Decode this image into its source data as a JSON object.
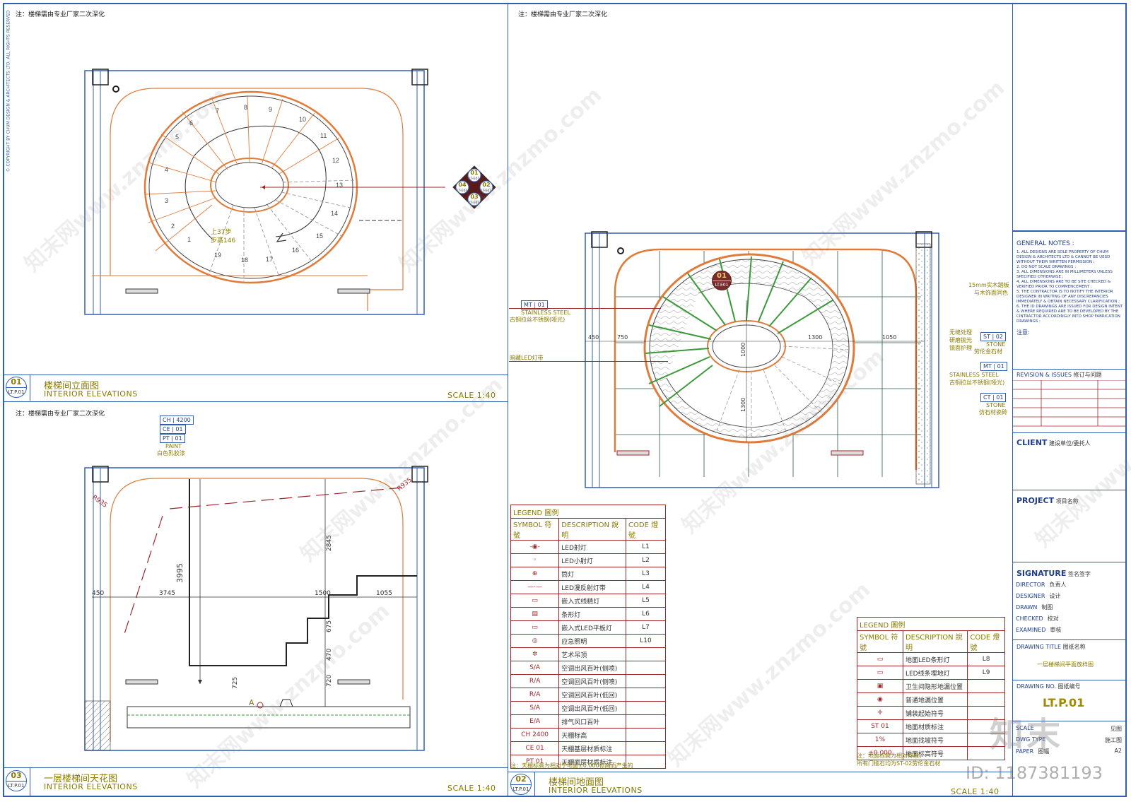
{
  "panels": {
    "p01": {
      "note": "注：楼梯需由专业厂家二次深化",
      "bubble_num": "01",
      "bubble_sheet": "LT.P.01",
      "title_cn": "楼梯间立面图",
      "title_en": "INTERIOR ELEVATIONS",
      "scale": "SCALE 1:40",
      "step_numbers": [
        "1",
        "2",
        "3",
        "4",
        "5",
        "6",
        "7",
        "8",
        "9",
        "10",
        "11",
        "12",
        "13",
        "14",
        "15",
        "16",
        "17",
        "18",
        "19"
      ],
      "step_note_1": "上37步",
      "step_note_2": "步高146",
      "section_marks": [
        {
          "num": "01",
          "sheet": "LT-E01"
        },
        {
          "num": "02",
          "sheet": "LT-E02"
        },
        {
          "num": "03",
          "sheet": "LT-E03"
        },
        {
          "num": "04",
          "sheet": "LT-E04"
        }
      ]
    },
    "p03": {
      "note": "注：楼梯需由专业厂家二次深化",
      "bubble_num": "03",
      "bubble_sheet": "LT.P.01",
      "title_cn": "一层楼梯间天花图",
      "title_en": "INTERIOR ELEVATIONS",
      "scale": "SCALE 1:40",
      "ceiling_tags": [
        {
          "code": "CH",
          "val": "4200"
        },
        {
          "code": "CE",
          "val": "01"
        },
        {
          "code": "PT",
          "val": "01"
        }
      ],
      "paint_label_en": "PAINT",
      "paint_label_cn": "白色乳胶漆",
      "dims": [
        "450",
        "3745",
        "1500",
        "1055",
        "3995",
        "2845",
        "675",
        "470",
        "720",
        "725",
        "R935",
        "R935"
      ],
      "mark_a": "A"
    },
    "p02": {
      "note": "注：楼梯需由专业厂家二次深化",
      "bubble_num": "02",
      "bubble_sheet": "LT.P.01",
      "title_cn": "楼梯间地面图",
      "title_en": "INTERIOR ELEVATIONS",
      "scale": "SCALE 1:40",
      "plan_bubble": "01",
      "plan_bubble_sheet": "LT.E01",
      "dims": [
        "450",
        "750",
        "1300",
        "1050",
        "1000",
        "1300"
      ],
      "tags": [
        {
          "code": "MT",
          "val": "01",
          "en": "STAINLESS STEEL",
          "cn": "古铜拉丝不锈钢(哑光)"
        },
        {
          "code": "ST",
          "val": "02",
          "en": "STONE",
          "cn": "劳伦金石材"
        },
        {
          "code": "MT",
          "val": "01",
          "en": "STAINLESS STEEL",
          "cn": "古铜拉丝不锈钢(哑光)"
        },
        {
          "code": "CT",
          "val": "01",
          "en": "STONE",
          "cn": "仿石材瓷砖"
        }
      ],
      "callout_wood": "15mm实木踏板",
      "callout_wood2": "与木饰面同色",
      "callout_led": "暗藏LED灯带",
      "callout_grout_1": "无缝处理",
      "callout_grout_2": "研磨抛光",
      "callout_grout_3": "镜面护理"
    }
  },
  "legend_ceiling": {
    "title": "LEGEND 圖例",
    "head": [
      "SYMBOL 符號",
      "DESCRIPTION 說明",
      "CODE 燈號"
    ],
    "rows": [
      {
        "sym": "-◉-",
        "desc": "LED射灯",
        "code": "L1"
      },
      {
        "sym": "◦",
        "desc": "LED小射灯",
        "code": "L2"
      },
      {
        "sym": "⊕",
        "desc": "筒灯",
        "code": "L3"
      },
      {
        "sym": "—·—",
        "desc": "LED漫反射灯带",
        "code": "L4"
      },
      {
        "sym": "▭",
        "desc": "嵌入式线精灯",
        "code": "L5"
      },
      {
        "sym": "▤",
        "desc": "条形灯",
        "code": "L6"
      },
      {
        "sym": "▭",
        "desc": "嵌入式LED平板灯",
        "code": "L7"
      },
      {
        "sym": "◎",
        "desc": "应急照明",
        "code": "L10"
      },
      {
        "sym": "✲",
        "desc": "艺术吊顶",
        "code": ""
      },
      {
        "sym": "S/A",
        "desc": "空调出风百叶(侧喷)",
        "code": ""
      },
      {
        "sym": "R/A",
        "desc": "空调回风百叶(侧喷)",
        "code": ""
      },
      {
        "sym": "R/A",
        "desc": "空调回风百叶(低回)",
        "code": ""
      },
      {
        "sym": "S/A",
        "desc": "空调出风百叶(低回)",
        "code": ""
      },
      {
        "sym": "E/A",
        "desc": "排气风口百叶",
        "code": ""
      },
      {
        "sym": "CH 2400",
        "desc": "天棚标高",
        "code": ""
      },
      {
        "sym": "CE 01",
        "desc": "天棚基层材质标注",
        "code": ""
      },
      {
        "sym": "PT 01",
        "desc": "天棚面层材质标注",
        "code": ""
      }
    ],
    "footnote": "注：天棚标高为相对于地面±0.000标高而产生的"
  },
  "legend_floor": {
    "title": "LEGEND 圖例",
    "head": [
      "SYMBOL 符號",
      "DESCRIPTION 說明",
      "CODE 燈號"
    ],
    "rows": [
      {
        "sym": "▭",
        "desc": "地面LED条形灯",
        "code": "L8"
      },
      {
        "sym": "▭",
        "desc": "LED线条埋地灯",
        "code": "L9"
      },
      {
        "sym": "▣",
        "desc": "卫生间隐形地漏位置",
        "code": ""
      },
      {
        "sym": "◉",
        "desc": "普通地漏位置",
        "code": ""
      },
      {
        "sym": "✛",
        "desc": "铺装起始符号",
        "code": ""
      },
      {
        "sym": "ST 01",
        "desc": "地面材质标注",
        "code": ""
      },
      {
        "sym": "1%",
        "desc": "地面找坡符号",
        "code": ""
      },
      {
        "sym": "±0.000",
        "desc": "地面标高符号",
        "code": ""
      }
    ],
    "footnote_1": "注：地面标高为相对标高，",
    "footnote_2": "所有门槛石均为ST-02劳伦金石材"
  },
  "title_block": {
    "general_notes_head": "GENERAL NOTES :",
    "general_notes": [
      "1. ALL DESIGNS ARE SOLE PROPERTY OF CHUM DESIGN & ARCHITECTS LTD & CANNOT BE UESD WITHOUT THEIR WRITTEN PERMISSION ;",
      "2. DO NOT SCALE DRAWINGS ;",
      "3. ALL DIMENSIONS ARE IN MILLIMETERS UNLESS SPECIFIED OTHERWISE ;",
      "4. ALL DIMENSIONS ARE TO BE SITE CHECKED & VERIFIED PRIOR TO COMMENCEMENT ;",
      "5. THE CONTRACTOR IS TO NOTIFY THE INTERIOR DESIGNER IN WRITING OF ANY DISCREPANCIES IMMEDIATELY & OBTAIN NECESSARY CLARIFICATION ;",
      "6. THE ID DRAWINGS ARE ISSUED FOR DESIGN INTENT & WHERE REQUIRED ARE TO BE DEVELOPED BY THE CINTRACTOR ACCORDINGLY INTO SHOP FABRICATION DRAWINGS ;"
    ],
    "notes_cn_head": "注意:",
    "revision": "REVISION & ISSUES",
    "revision_cn": "修订与问题",
    "client": "CLIENT",
    "client_cn": "建设单位/委托人",
    "project": "PROJECT",
    "project_cn": "项目名称",
    "signature": "SIGNATURE",
    "signature_cn": "签名签字",
    "sig_rows": [
      {
        "en": "DIRECTOR",
        "cn": "负责人"
      },
      {
        "en": "DESIGNER",
        "cn": "设计"
      },
      {
        "en": "DRAWN",
        "cn": "制图"
      },
      {
        "en": "CHECKED",
        "cn": "校对"
      },
      {
        "en": "EXAMINED",
        "cn": "审核"
      }
    ],
    "drawing_title": "DRAWING TITLE",
    "drawing_title_cn": "图纸名称",
    "drawing_title_val": "一层楼梯间平面放样图",
    "drawing_no": "DRAWING NO.",
    "drawing_no_cn": "图纸编号",
    "drawing_no_val": "LT.P.01",
    "scale_row": {
      "en": "SCALE",
      "val": "见图"
    },
    "type_row": {
      "en": "DWG TYPE",
      "val": "施工图"
    },
    "paper_row": {
      "en": "PAPER",
      "cn": "图幅",
      "val": "A2"
    }
  },
  "copyright": "© COPYRIGHT BY CHUM DESIGN & ARCHITECTS LTD. ALL RIGHTS RESERVED",
  "watermark": {
    "text": "知末网www.znzmo.com",
    "logo": "知末",
    "id": "ID: 1187381193"
  },
  "colors": {
    "frame": "#2f5fb3",
    "wall": "#e07b39",
    "accent": "#8a7a00",
    "legend": "#a0262a",
    "glass": "#3a9a3a"
  }
}
